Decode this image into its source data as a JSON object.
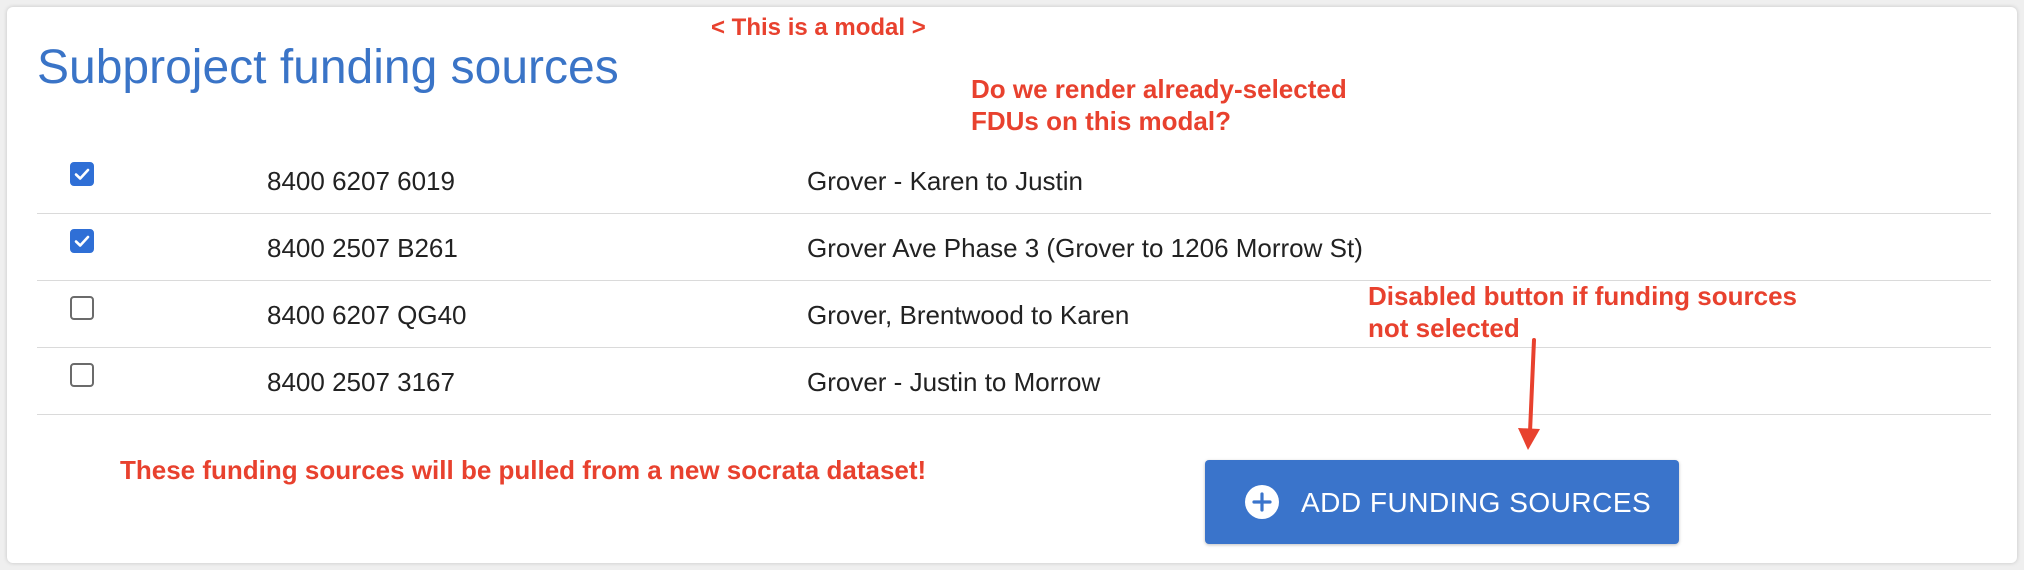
{
  "modal": {
    "title": "Subproject funding sources",
    "rows": [
      {
        "checked": true,
        "fdu": "8400 6207 6019",
        "description": "Grover - Karen to Justin"
      },
      {
        "checked": true,
        "fdu": "8400 2507 B261",
        "description": "Grover Ave Phase 3 (Grover to 1206 Morrow St)"
      },
      {
        "checked": false,
        "fdu": "8400 6207 QG40",
        "description": "Grover, Brentwood to Karen"
      },
      {
        "checked": false,
        "fdu": "8400 2507 3167",
        "description": "Grover - Justin to Morrow"
      }
    ],
    "add_button": {
      "label": "ADD FUNDING SOURCES",
      "icon": "plus-circle-icon"
    }
  },
  "annotations": {
    "modal_note": "< This is a modal >",
    "render_note_line1": "Do we render already-selected",
    "render_note_line2": "FDUs on this modal?",
    "disabled_note_line1": "Disabled button if funding sources",
    "disabled_note_line2": "not selected",
    "socrata_note": "These funding sources will be pulled from a new socrata dataset!"
  },
  "colors": {
    "title": "#3a74c7",
    "checkbox_checked": "#2f6fd6",
    "button": "#3a74cb",
    "annotation": "#e8412e"
  }
}
